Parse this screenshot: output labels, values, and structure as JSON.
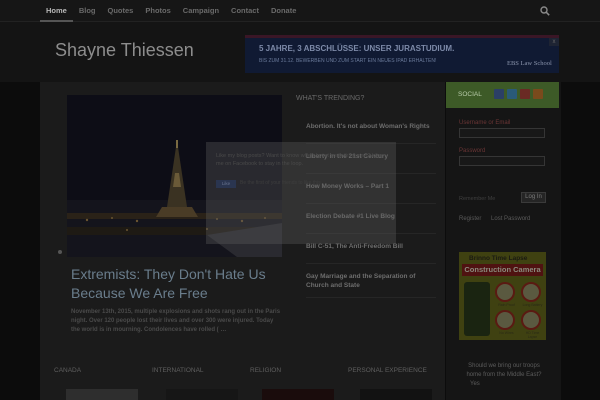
{
  "nav": {
    "items": [
      {
        "label": "Home",
        "active": true
      },
      {
        "label": "Blog",
        "active": false
      },
      {
        "label": "Quotes",
        "active": false
      },
      {
        "label": "Photos",
        "active": false
      },
      {
        "label": "Campaign",
        "active": false
      },
      {
        "label": "Contact",
        "active": false
      },
      {
        "label": "Donate",
        "active": false
      }
    ],
    "search_icon": "search-icon"
  },
  "header": {
    "site_title": "Shayne Thiessen",
    "ad": {
      "line1": "5 JAHRE, 3 ABSCHLÜSSE: UNSER JURASTUDIUM.",
      "line2": "BIS ZUM 31.12. BEWERBEN UND ZUM START EIN NEUES IPAD ERHALTEN!",
      "logo": "EBS Law School",
      "close": "x"
    }
  },
  "feature": {
    "title": "Extremists: They Don't Hate Us Because We Are Free",
    "excerpt": "November 13th, 2015, multiple explosions and shots rang out in the Paris night. Over 120 people lost their lives and over 300 were injured. Today the world is in mourning. Condolences have rolled ( …"
  },
  "trending": {
    "heading": "WHAT'S TRENDING?",
    "items": [
      "Abortion. It's not about Woman's Rights",
      "Liberty in the 21st Century",
      "How Money Works – Part 1",
      "Election Debate #1 Live Blog",
      "Bill C-51, The Anti-Freedom Bill",
      "Gay Marriage and the Separation of Church and State"
    ]
  },
  "categories": [
    "CANADA",
    "INTERNATIONAL",
    "RELIGION",
    "PERSONAL EXPERIENCE"
  ],
  "sidebar": {
    "social_label": "SOCIAL",
    "social_icons": [
      {
        "name": "facebook-icon",
        "color": "#2b3f66"
      },
      {
        "name": "twitter-icon",
        "color": "#2a5a78"
      },
      {
        "name": "google-plus-icon",
        "color": "#6a2a24"
      },
      {
        "name": "rss-icon",
        "color": "#7a4a1c"
      }
    ],
    "login": {
      "username_label": "Username or Email",
      "password_label": "Password",
      "remember_label": "Remember Me",
      "button": "Log In",
      "register": "Register",
      "lost_password": "Lost Password"
    },
    "cam_ad": {
      "line1": "Brinno Time Lapse",
      "line2": "Construction Camera",
      "signs": [
        "Rain Proof",
        "Long Battery",
        "No Wires",
        "HD Time Lapse"
      ]
    },
    "poll": {
      "question": "Should we bring our troops home from the Middle East?",
      "option": "Yes"
    }
  },
  "popup": {
    "text": "Like my blog posts? Want to know when I post something new? Like me on Facebook to stay in the loop.",
    "fb_button": "Like",
    "fb_text": "Be the first of your friends to like this"
  }
}
